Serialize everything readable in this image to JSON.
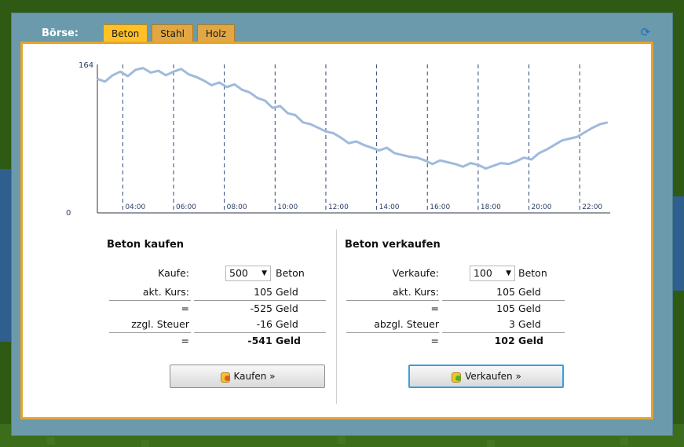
{
  "window": {
    "title": "Börse:"
  },
  "tabs": [
    {
      "label": "Beton",
      "active": true
    },
    {
      "label": "Stahl",
      "active": false
    },
    {
      "label": "Holz",
      "active": false
    }
  ],
  "icons": {
    "refresh": "refresh-icon",
    "coin": "coins-icon"
  },
  "colors": {
    "tab_active": "#ffc125",
    "tab": "#e2a743",
    "line": "#9fbadc",
    "window": "#6a9aab",
    "panel_border": "#e8a42a"
  },
  "chart_data": {
    "type": "line",
    "title": "",
    "xlabel": "",
    "ylabel": "",
    "ylim": [
      0,
      164
    ],
    "y_ticks": [
      "164",
      "0"
    ],
    "x_ticks": [
      "04:00",
      "06:00",
      "08:00",
      "10:00",
      "12:00",
      "14:00",
      "16:00",
      "18:00",
      "20:00",
      "22:00"
    ],
    "x_hours": [
      3,
      23.2
    ],
    "grid": "vertical dashed",
    "series": [
      {
        "x": [
          3.0,
          3.3,
          3.6,
          3.9,
          4.2,
          4.5,
          4.8,
          5.1,
          5.4,
          5.7,
          6.0,
          6.3,
          6.6,
          6.9,
          7.2,
          7.5,
          7.8,
          8.1,
          8.4,
          8.7,
          9.0,
          9.3,
          9.6,
          9.9,
          10.2,
          10.5,
          10.8,
          11.1,
          11.4,
          11.7,
          12.0,
          12.3,
          12.6,
          12.9,
          13.2,
          13.5,
          13.8,
          14.1,
          14.4,
          14.7,
          15.0,
          15.3,
          15.6,
          15.9,
          16.2,
          16.5,
          16.8,
          17.1,
          17.4,
          17.7,
          18.0,
          18.3,
          18.6,
          18.9,
          19.2,
          19.5,
          19.8,
          20.1,
          20.4,
          20.7,
          21.0,
          21.3,
          21.6,
          21.9,
          22.2,
          22.5,
          22.8,
          23.1
        ],
        "values": [
          148,
          145,
          152,
          156,
          151,
          158,
          160,
          155,
          157,
          152,
          156,
          159,
          153,
          150,
          146,
          141,
          144,
          139,
          142,
          136,
          133,
          127,
          124,
          116,
          118,
          110,
          108,
          100,
          98,
          94,
          90,
          88,
          83,
          77,
          79,
          75,
          72,
          69,
          72,
          66,
          64,
          62,
          61,
          58,
          54,
          58,
          56,
          54,
          51,
          55,
          53,
          49,
          52,
          55,
          54,
          57,
          61,
          59,
          66,
          70,
          75,
          80,
          82,
          84,
          89,
          94,
          98,
          100
        ]
      }
    ]
  },
  "buy": {
    "heading": "Beton kaufen",
    "qty_label": "Kaufe:",
    "qty_value": "500",
    "qty_unit": "Beton",
    "rate_label": "akt. Kurs:",
    "rate_value": "105",
    "rate_unit": "Geld",
    "eq1": "=",
    "sum_value": "-525",
    "sum_unit": "Geld",
    "tax_label": "zzgl. Steuer",
    "tax_value": "-16",
    "tax_unit": "Geld",
    "eq2": "=",
    "total": "-541 Geld",
    "button": "Kaufen »"
  },
  "sell": {
    "heading": "Beton verkaufen",
    "qty_label": "Verkaufe:",
    "qty_value": "100",
    "qty_unit": "Beton",
    "rate_label": "akt. Kurs:",
    "rate_value": "105",
    "rate_unit": "Geld",
    "eq1": "=",
    "sum_value": "105",
    "sum_unit": "Geld",
    "tax_label": "abzgl. Steuer",
    "tax_value": "3",
    "tax_unit": "Geld",
    "eq2": "=",
    "total": "102 Geld",
    "button": "Verkaufen »"
  }
}
